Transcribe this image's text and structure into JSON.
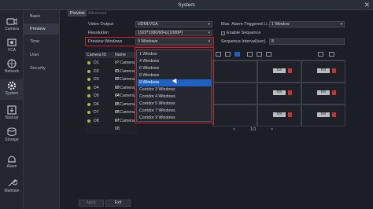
{
  "window": {
    "title": "System",
    "close_label": "✕"
  },
  "nav": [
    {
      "label": "Camera",
      "icon": "camera-icon"
    },
    {
      "label": "VCA",
      "icon": "vca-icon"
    },
    {
      "label": "Network",
      "icon": "network-icon"
    },
    {
      "label": "System",
      "icon": "system-gear-icon",
      "active": true
    },
    {
      "label": "Backup",
      "icon": "backup-icon"
    },
    {
      "label": "Storage",
      "icon": "storage-icon"
    },
    {
      "label": "Alarm",
      "icon": "alarm-icon"
    },
    {
      "label": "Maintain",
      "icon": "maintain-icon"
    }
  ],
  "submenu": [
    "Basic",
    "Preview",
    "Time",
    "User",
    "Security"
  ],
  "tabs": [
    "Preview",
    "Advanced"
  ],
  "settings": {
    "video_output_label": "Video Output",
    "video_output_value": "HDMI/VGA",
    "resolution_label": "Resolution",
    "resolution_value": "1920*1080/60Hz(1080P)",
    "preview_windows_label": "Preview Windows",
    "preview_windows_value": "9 Windows",
    "max_alarm_label": "Max. Alarm-Triggered Li...",
    "max_alarm_value": "1 Window",
    "enable_sequence_label": "Enable Sequence",
    "sequence_interval_label": "Sequence Interval(sec)",
    "sequence_interval_value": "8"
  },
  "camera_list": {
    "headers": [
      "Camera ID",
      "Name"
    ],
    "rows": [
      [
        "D1",
        "IP Camera 01"
      ],
      [
        "D2",
        "IP Camera 02"
      ],
      [
        "D3",
        "IP Camera 03"
      ],
      [
        "D4",
        "IP Camera 04"
      ],
      [
        "D5",
        "IP Camera 05"
      ],
      [
        "D6",
        "IP Camera 06"
      ],
      [
        "D7",
        "IP Camera 07"
      ],
      [
        "D8",
        "IP Camera 08"
      ]
    ]
  },
  "dropdown_options": [
    "1 Window",
    "4 Windows",
    "6 Windows",
    "8 Windows",
    "9 Windows",
    "Corridor 3 Windows",
    "Corridor 4 Windows",
    "Corridor 5 Windows",
    "Corridor 7 Windows",
    "Corridor 9 Windows"
  ],
  "dropdown_selected_index": 4,
  "grid_labels": [
    "D2",
    "D3",
    "D5",
    "D6",
    "D8",
    "D9"
  ],
  "pager": {
    "prev": "<",
    "page": "1/1",
    "next": ">"
  },
  "buttons": {
    "apply": "Apply",
    "exit": "Exit"
  },
  "colors": {
    "accent_blue": "#1e63c4",
    "highlight_red": "#d11d2b",
    "online_green": "#9fbf4a"
  }
}
